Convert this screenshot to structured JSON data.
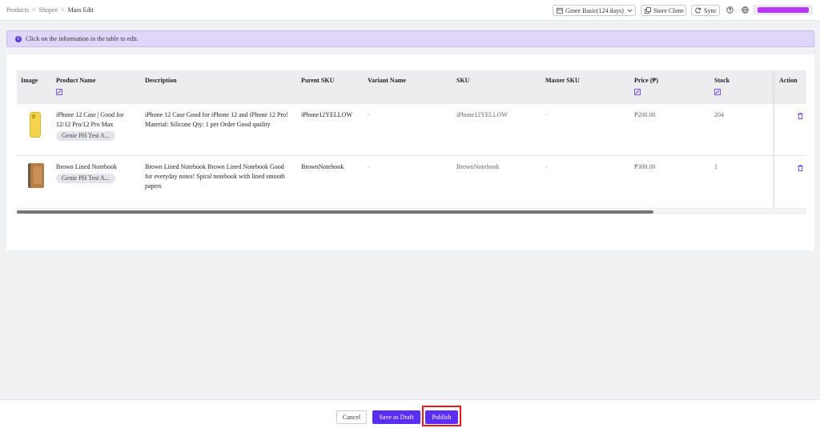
{
  "breadcrumb": {
    "items": [
      "Products",
      "Shopee"
    ],
    "current": "Mass Edit",
    "separator": ">"
  },
  "topbar": {
    "plan_label": "Ginee Basic(124 days)",
    "store_clone_label": "Store Clone",
    "sync_label": "Sync",
    "icons": {
      "plan": "calendar-icon",
      "help": "help-icon",
      "language": "globe-icon"
    }
  },
  "notice": {
    "text": "Click on the information in the table to edit."
  },
  "table": {
    "headers": {
      "image": "Image",
      "product_name": "Product Name",
      "description": "Description",
      "parent_sku": "Parent SKU",
      "variant_name": "Variant Name",
      "sku": "SKU",
      "master_sku": "Master SKU",
      "price": "Price (₱)",
      "stock": "Stock",
      "action": "Action"
    },
    "rows": [
      {
        "product_name": "iPhone 12 Case | Good for 12/12 Pro/12 Pro Max",
        "store_tag": "Genie PH Test A...",
        "description": "iPhone 12 Case Good for iPhone 12 and iPhone 12 Pro! Material: Silicone Qty: 1 per Order Good quality",
        "parent_sku": "iPhone12YELLOW",
        "variant_name": "-",
        "sku": "iPhone12YELLOW",
        "master_sku": "-",
        "price": "₱200.00",
        "stock": "204"
      },
      {
        "product_name": "Brown Lined Notebook",
        "store_tag": "Genie PH Test A...",
        "description": "Brown Lined Notebook Brown Lined Notebook Good for everyday notes! Spiral notebook with lined smooth papers",
        "parent_sku": "BrownNotebook",
        "variant_name": "-",
        "sku": "BrownNotebook",
        "master_sku": "-",
        "price": "₱300.00",
        "stock": "1"
      }
    ]
  },
  "footer": {
    "cancel_label": "Cancel",
    "draft_label": "Save as Draft",
    "publish_label": "Publish"
  },
  "colors": {
    "primary": "#5b2ef5",
    "notice_bg": "#ddd6f9",
    "highlight": "#ee1515"
  }
}
